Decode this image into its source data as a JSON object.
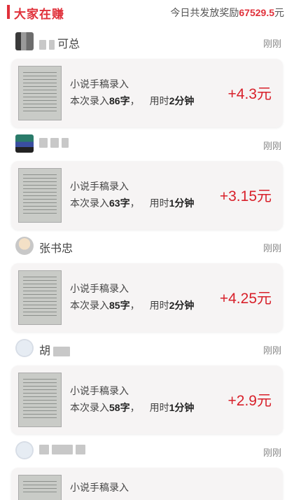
{
  "header": {
    "title": "大家在赚",
    "summary_label": "今日共发放奖励",
    "summary_amount": "67529.5",
    "summary_unit": "元"
  },
  "entries": [
    {
      "username": "可总",
      "avatar_style": "pixelated",
      "time": "刚刚",
      "task": "小说手稿录入",
      "stats_prefix": "本次录入",
      "chars": "86字",
      "stats_mid": "用时",
      "duration": "2分钟",
      "reward": "+4.3元"
    },
    {
      "username": "",
      "avatar_style": "pixelated",
      "time": "刚刚",
      "task": "小说手稿录入",
      "stats_prefix": "本次录入",
      "chars": "63字",
      "stats_mid": "用时",
      "duration": "1分钟",
      "reward": "+3.15元"
    },
    {
      "username": "张书忠",
      "avatar_style": "photo",
      "time": "刚刚",
      "task": "小说手稿录入",
      "stats_prefix": "本次录入",
      "chars": "85字",
      "stats_mid": "用时",
      "duration": "2分钟",
      "reward": "+4.25元"
    },
    {
      "username": "胡",
      "avatar_style": "default",
      "time": "刚刚",
      "task": "小说手稿录入",
      "stats_prefix": "本次录入",
      "chars": "58字",
      "stats_mid": "用时",
      "duration": "1分钟",
      "reward": "+2.9元"
    },
    {
      "username": "",
      "avatar_style": "default",
      "time": "刚刚",
      "task": "小说手稿录入",
      "stats_prefix": "",
      "chars": "",
      "stats_mid": "",
      "duration": "",
      "reward": ""
    }
  ],
  "colors": {
    "accent": "#e0303a",
    "reward": "#d8202a",
    "card_bg": "#f6f4f4"
  }
}
